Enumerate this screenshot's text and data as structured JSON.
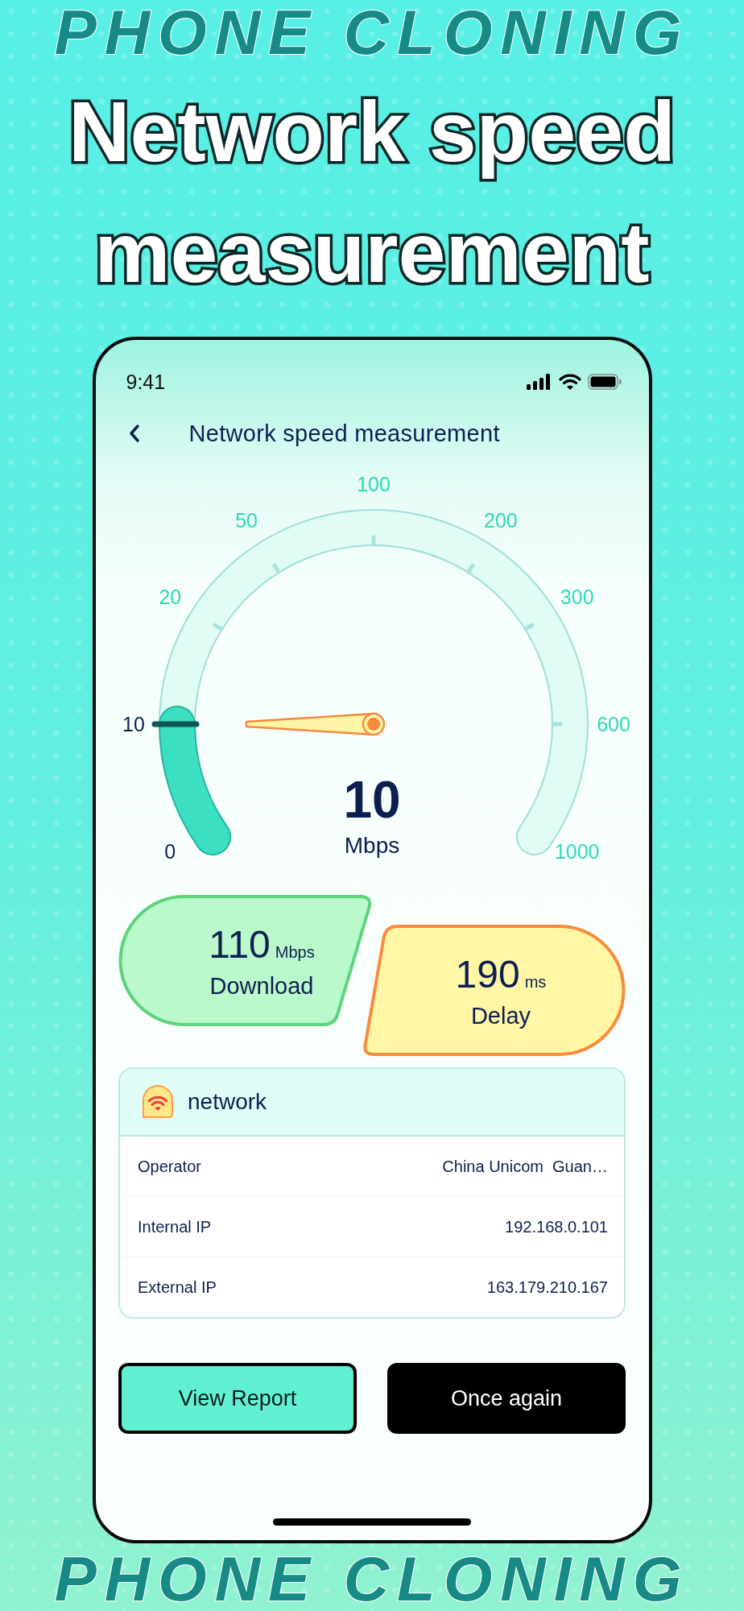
{
  "decor_text": [
    "PHONE CLONING",
    "PHONE CLONING"
  ],
  "headline": "Network speed measurement",
  "status_bar": {
    "time": "9:41"
  },
  "nav": {
    "title": "Network speed measurement"
  },
  "gauge": {
    "reading": "10",
    "unit": "Mbps",
    "ticks": [
      {
        "label": "0",
        "reached": true
      },
      {
        "label": "10",
        "reached": true
      },
      {
        "label": "20",
        "reached": false
      },
      {
        "label": "50",
        "reached": false
      },
      {
        "label": "100",
        "reached": false
      },
      {
        "label": "200",
        "reached": false
      },
      {
        "label": "300",
        "reached": false
      },
      {
        "label": "600",
        "reached": false
      },
      {
        "label": "1000",
        "reached": false
      }
    ]
  },
  "results": [
    {
      "kind": "download",
      "value": "110",
      "unit": "Mbps",
      "label": "Download"
    },
    {
      "kind": "delay",
      "value": "190",
      "unit": "ms",
      "label": "Delay"
    }
  ],
  "network": {
    "title": "network",
    "rows": [
      {
        "label": "Operator",
        "value": "China Unicom  Guan…"
      },
      {
        "label": "Internal IP",
        "value": "192.168.0.101"
      },
      {
        "label": "External IP",
        "value": "163.179.210.167"
      }
    ]
  },
  "buttons": [
    {
      "kind": "outline",
      "label": "View Report"
    },
    {
      "kind": "solid",
      "label": "Once again"
    }
  ]
}
